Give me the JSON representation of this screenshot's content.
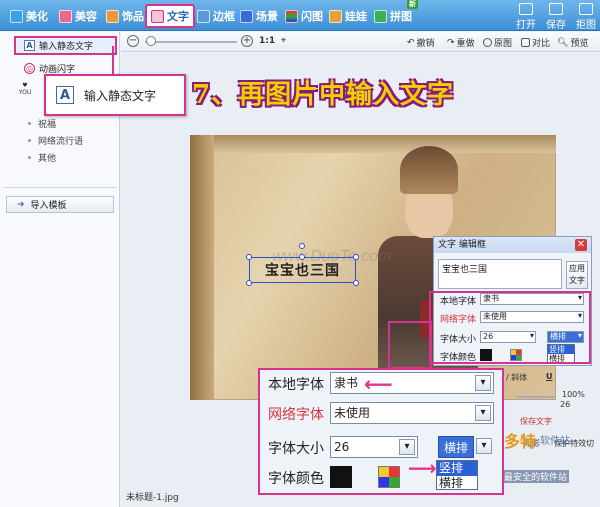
{
  "tabs": [
    {
      "label": "美化",
      "color": "#3aa3e8"
    },
    {
      "label": "美容",
      "color": "#e86a8a"
    },
    {
      "label": "饰品",
      "color": "#e89a3a"
    },
    {
      "label": "文字",
      "color": "#d6338c",
      "active": true
    },
    {
      "label": "边框",
      "color": "#5a9ad8"
    },
    {
      "label": "场景",
      "color": "#3a6ad8"
    },
    {
      "label": "闪图",
      "color": "#d83a3a"
    },
    {
      "label": "娃娃",
      "color": "#e8a03a"
    },
    {
      "label": "拼图",
      "color": "#3ab05a",
      "badge": "新"
    }
  ],
  "right_tools": [
    "打开",
    "保存",
    "拒图"
  ],
  "left_panel": {
    "item_static": "输入静态文字",
    "item_animated": "动画闪字",
    "sub_items": [
      "祝福",
      "网络流行语",
      "其他"
    ],
    "import_button": "导入模板"
  },
  "toolbar": {
    "zoom_ratio": "1:1",
    "undo": "撤销",
    "redo": "重做",
    "original": "原图",
    "compare": "对比",
    "preview": "预览"
  },
  "canvas": {
    "text_content": "宝宝也三国",
    "filename": "未标题-1.jpg",
    "watermark": "www.DuoTe.com"
  },
  "dialog": {
    "title": "文字 编辑框",
    "text_value": "宝宝也三国",
    "apply": "应用文字",
    "local_font_label": "本地字体",
    "local_font_value": "隶书",
    "net_font_label": "网络字体",
    "net_font_value": "未使用",
    "size_label": "字体大小",
    "size_value": "26",
    "orient_value": "横排",
    "color_label": "字体颜色",
    "orient_options": [
      "竖排",
      "横排"
    ]
  },
  "callout": {
    "label": "输入静态文字",
    "step_text": "7、再图片中输入文字"
  },
  "misc": {
    "italic": "斜体",
    "percent": "100%",
    "num": "26",
    "site_top": "多特",
    "site_sub": "软件站",
    "site_caption": "国内最安全的软件站",
    "save_text": "保存文字",
    "misc_a": "阳影",
    "misc_b": "保护特效切"
  },
  "accent": "#d6338c"
}
